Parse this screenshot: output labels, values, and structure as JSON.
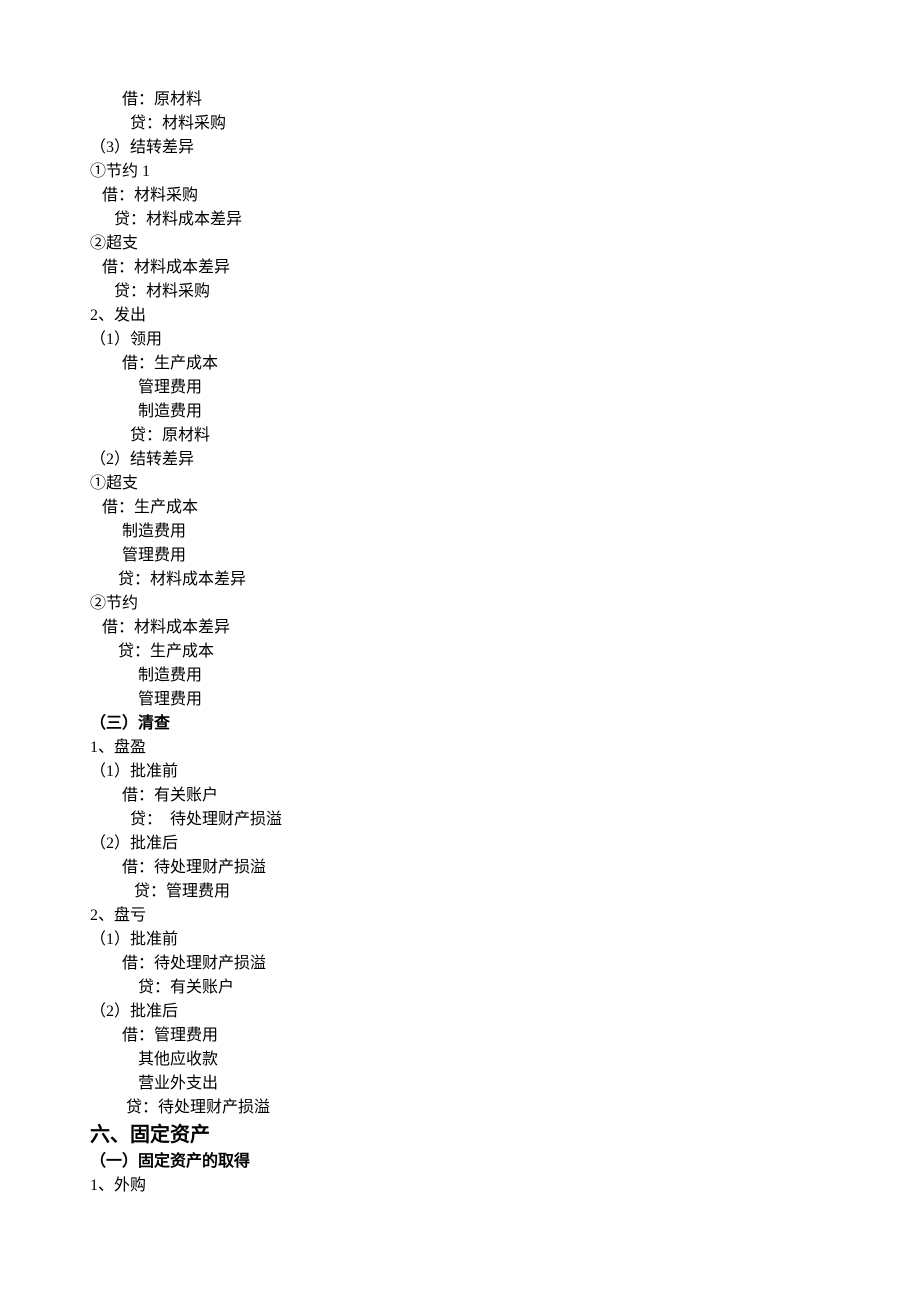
{
  "lines": [
    {
      "text": "        借：原材料"
    },
    {
      "text": "          贷：材料采购"
    },
    {
      "text": "（3）结转差异"
    },
    {
      "text": "①节约 1"
    },
    {
      "text": "   借：材料采购"
    },
    {
      "text": "      贷：材料成本差异"
    },
    {
      "text": "②超支"
    },
    {
      "text": "   借：材料成本差异"
    },
    {
      "text": "      贷：材料采购"
    },
    {
      "text": "2、发出"
    },
    {
      "text": "（1）领用"
    },
    {
      "text": "        借：生产成本"
    },
    {
      "text": "            管理费用"
    },
    {
      "text": "            制造费用"
    },
    {
      "text": "          贷：原材料"
    },
    {
      "text": "（2）结转差异"
    },
    {
      "text": "①超支"
    },
    {
      "text": "   借：生产成本"
    },
    {
      "text": "        制造费用"
    },
    {
      "text": "        管理费用"
    },
    {
      "text": "       贷：材料成本差异"
    },
    {
      "text": "②节约"
    },
    {
      "text": "   借：材料成本差异"
    },
    {
      "text": "       贷：生产成本"
    },
    {
      "text": "            制造费用"
    },
    {
      "text": "            管理费用"
    },
    {
      "text": "（三）清查",
      "bold": true
    },
    {
      "text": "1、盘盈"
    },
    {
      "text": "（1）批准前"
    },
    {
      "text": "        借：有关账户"
    },
    {
      "text": "          贷：  待处理财产损溢"
    },
    {
      "text": "（2）批准后"
    },
    {
      "text": "        借：待处理财产损溢"
    },
    {
      "text": "           贷：管理费用"
    },
    {
      "text": "2、盘亏"
    },
    {
      "text": "（1）批准前"
    },
    {
      "text": "        借：待处理财产损溢"
    },
    {
      "text": "            贷：有关账户"
    },
    {
      "text": "（2）批准后"
    },
    {
      "text": "        借：管理费用"
    },
    {
      "text": "            其他应收款"
    },
    {
      "text": "            营业外支出"
    },
    {
      "text": "         贷：待处理财产损溢"
    },
    {
      "text": "六、固定资产",
      "h1": true
    },
    {
      "text": "（一）固定资产的取得",
      "bold": true
    },
    {
      "text": "1、外购"
    }
  ]
}
